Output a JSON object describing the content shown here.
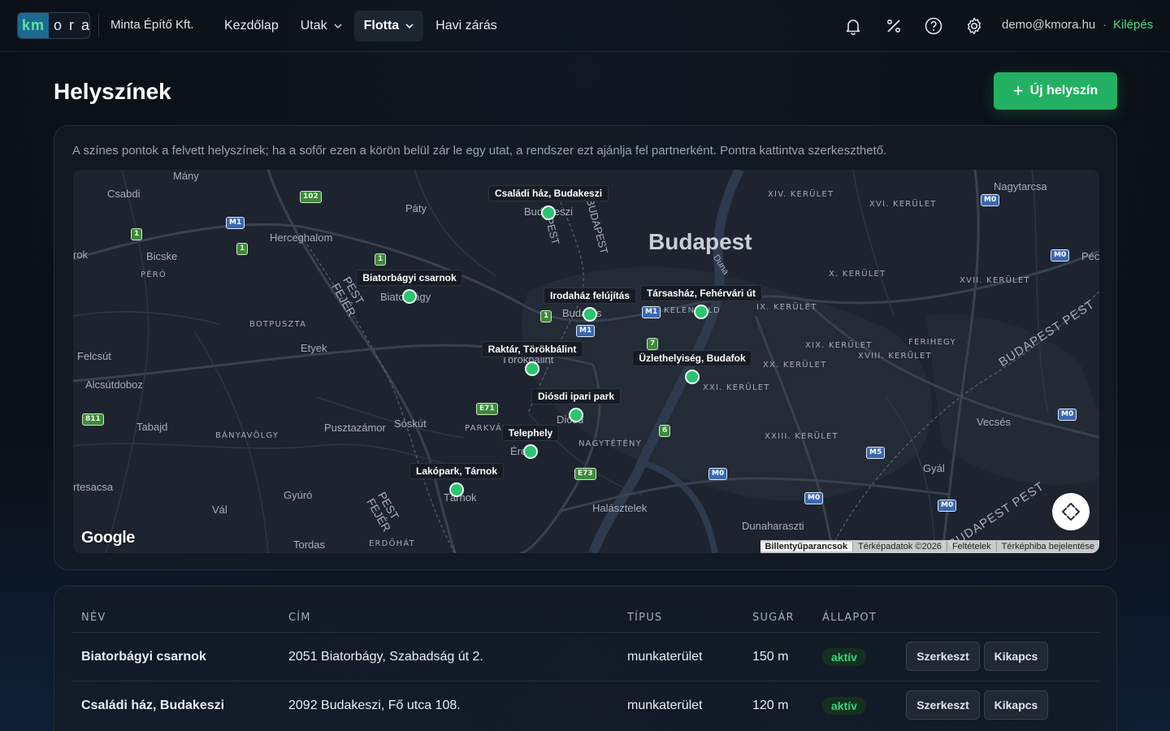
{
  "brand": {
    "logo_left": "km",
    "logo_right": "ora",
    "company": "Minta Építő Kft."
  },
  "nav": {
    "items": [
      {
        "label": "Kezdőlap",
        "dropdown": false,
        "active": false
      },
      {
        "label": "Utak",
        "dropdown": true,
        "active": false
      },
      {
        "label": "Flotta",
        "dropdown": true,
        "active": true
      },
      {
        "label": "Havi zárás",
        "dropdown": false,
        "active": false
      }
    ],
    "icons": [
      "bell-icon",
      "percent-icon",
      "help-icon",
      "gear-icon"
    ],
    "user_email": "demo@kmora.hu",
    "separator": "·",
    "logout": "Kilépés"
  },
  "page": {
    "title": "Helyszínek",
    "new_button": "Új helyszín",
    "new_button_icon": "+"
  },
  "map_card": {
    "hint": "A színes pontok a felvett helyszínek; ha a sofőr ezen a körön belül zár le egy utat, a rendszer ezt ajánlja fel partnerként. Pontra kattintva szerkeszthető.",
    "places": {
      "many": "Mány",
      "csabdi": "Csabdi",
      "paty": "Páty",
      "herceghalom": "Herceghalom",
      "bicske": "Bicske",
      "rok": "rok",
      "pero": "PÉRÓ",
      "botpuszta": "BOTPUSZTA",
      "etyek": "Etyek",
      "felcsut": "Felcsút",
      "alcsutdoboz": "Alcsútdoboz",
      "tabajd": "Tabajd",
      "banyavolgy": "BÁNYAVÖLGY",
      "pusztazamor": "Pusztazámor",
      "soskut": "Sóskút",
      "parkvar": "PARKVÁR",
      "gyuro": "Gyúró",
      "val": "Vál",
      "tesacsa": "rtesacsa",
      "tordas": "Tordas",
      "erdohat": "ERDŐHÁT",
      "budapest": "Budapest",
      "duna": "Duna",
      "nagytarcsa": "Nagytarcsa",
      "xiv": "XIV. KERÜLET",
      "xvi": "XVI. KERÜLET",
      "x": "X. KERÜLET",
      "xvii": "XVII. KERÜLET",
      "ix": "IX. KERÜLET",
      "xix": "XIX. KERÜLET",
      "ferihegy": "FERIHEGY",
      "xviii": "XVIII. KERÜLET",
      "xx": "XX. KERÜLET",
      "xxi": "XXI. KERÜLET",
      "xxiii": "XXIII. KERÜLET",
      "nagyteteny": "NAGYTÉTÉNY",
      "kelenfold": "KELENFÖLD",
      "vecses": "Vecsés",
      "gyal": "Gyál",
      "halasztelek": "Halásztelek",
      "dunaharaszti": "Dunaharaszti",
      "pec": "Péc",
      "pest_fejer1": "PEST\nFEJÉR",
      "budapest_pest1": "BUDAPEST PEST",
      "budapest_pest2": "BUDAPEST PEST",
      "budapest_vert": "BUDAPEST",
      "pest_vert": "PEST",
      "biatorbagy_town": "Biatorbágy",
      "budakeszi_town": "Budakeszi",
      "budaors_town": "Budaörs",
      "torokbalint_town": "Törökbálint",
      "diosd_town": "Diósd",
      "erd_town": "Érd",
      "tarnok_town": "Tárnok"
    },
    "shields": {
      "r102": "102",
      "m1a": "M1",
      "r1a": "1",
      "r1b": "1",
      "r1c": "1",
      "r1d": "1",
      "m0a": "M0",
      "m0b": "M0",
      "m0c": "M0",
      "m0d": "M0",
      "m0e": "M0",
      "m0f": "M0",
      "m1b": "M1",
      "m1c": "M1",
      "r7": "7",
      "r6": "6",
      "e71": "E71",
      "e73": "E73",
      "m5": "M5",
      "r811": "811"
    },
    "pins": [
      {
        "label": "Családi ház, Budakeszi"
      },
      {
        "label": "Biatorbágyi csarnok"
      },
      {
        "label": "Irodaház felújítás"
      },
      {
        "label": "Társasház, Fehérvári út"
      },
      {
        "label": "Raktár, Törökbálint"
      },
      {
        "label": "Üzlethelyiség, Budafok"
      },
      {
        "label": "Diósdi ipari park"
      },
      {
        "label": "Telephely"
      },
      {
        "label": "Lakópark, Tárnok"
      }
    ],
    "google_logo": "Google",
    "attribution": [
      "Billentyűparancsok",
      "Térképadatok ©2026",
      "Feltételek",
      "Térképhiba bejelentése"
    ],
    "fullscreen_icon": "fullscreen-icon"
  },
  "table": {
    "headers": {
      "name": "NÉV",
      "address": "CÍM",
      "type": "TÍPUS",
      "radius": "SUGÁR",
      "status": "ÁLLAPOT"
    },
    "rows": [
      {
        "name": "Biatorbágyi csarnok",
        "address": "2051 Biatorbágy, Szabadság út 2.",
        "type": "munkaterület",
        "radius": "150 m",
        "status": "aktív",
        "edit": "Szerkeszt",
        "toggle": "Kikapcs"
      },
      {
        "name": "Családi ház, Budakeszi",
        "address": "2092 Budakeszi, Fő utca 108.",
        "type": "munkaterület",
        "radius": "120 m",
        "status": "aktív",
        "edit": "Szerkeszt",
        "toggle": "Kikapcs"
      }
    ]
  },
  "colors": {
    "accent": "#22b163",
    "link": "#4fd88c",
    "pin": "#2bc46f",
    "badge_text": "#3bd27f"
  }
}
